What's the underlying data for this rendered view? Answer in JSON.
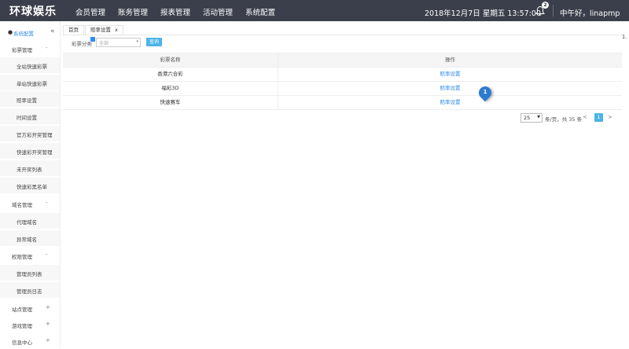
{
  "header": {
    "logo": "环球娱乐",
    "nav": [
      "会员管理",
      "账务管理",
      "报表管理",
      "活动管理",
      "系统配置"
    ],
    "datetime": "2018年12月7日 星期五 13:57:00",
    "notification_count": "2",
    "greeting": "中午好，linapmp"
  },
  "sidebar": {
    "title": "系统配置",
    "collapse_icon": "«",
    "items": [
      {
        "label": "彩票管理",
        "toggle": "-",
        "type": "group"
      },
      {
        "label": "全站快速彩票",
        "type": "child"
      },
      {
        "label": "单站快速彩票",
        "type": "child"
      },
      {
        "label": "赔率设置",
        "type": "child"
      },
      {
        "label": "时间设置",
        "type": "child"
      },
      {
        "label": "官方彩开奖管理",
        "type": "child"
      },
      {
        "label": "快速彩开奖管理",
        "type": "child"
      },
      {
        "label": "未开奖列表",
        "type": "child"
      },
      {
        "label": "快速彩黑名单",
        "type": "child"
      },
      {
        "label": "域名管理",
        "toggle": "-",
        "type": "group"
      },
      {
        "label": "代理域名",
        "type": "child"
      },
      {
        "label": "异常域名",
        "type": "child"
      },
      {
        "label": "权限管理",
        "toggle": "-",
        "type": "group"
      },
      {
        "label": "管理员列表",
        "type": "child"
      },
      {
        "label": "管理员日志",
        "type": "child"
      },
      {
        "label": "站点管理",
        "toggle": "+",
        "type": "group"
      },
      {
        "label": "游戏管理",
        "toggle": "+",
        "type": "group"
      },
      {
        "label": "信息中心",
        "toggle": "+",
        "type": "group"
      }
    ]
  },
  "tabs": {
    "home": "首页",
    "odds": "赔率设置",
    "close": "x"
  },
  "filter": {
    "label": "彩票分类",
    "select_value": "全部",
    "search_button": "查询"
  },
  "table": {
    "headers": [
      "彩票名称",
      "操作"
    ],
    "rows": [
      {
        "name": "香港六合彩",
        "action": "赔率设置"
      },
      {
        "name": "福彩3D",
        "action": "赔率设置"
      },
      {
        "name": "快速赛车",
        "action": "赔率设置"
      }
    ]
  },
  "pagination": {
    "page_size": "25",
    "info": "条/页，共 35 条",
    "prev": "<",
    "current": "1",
    "next": ">"
  },
  "marker": {
    "label": "1"
  },
  "edge_text": "1."
}
